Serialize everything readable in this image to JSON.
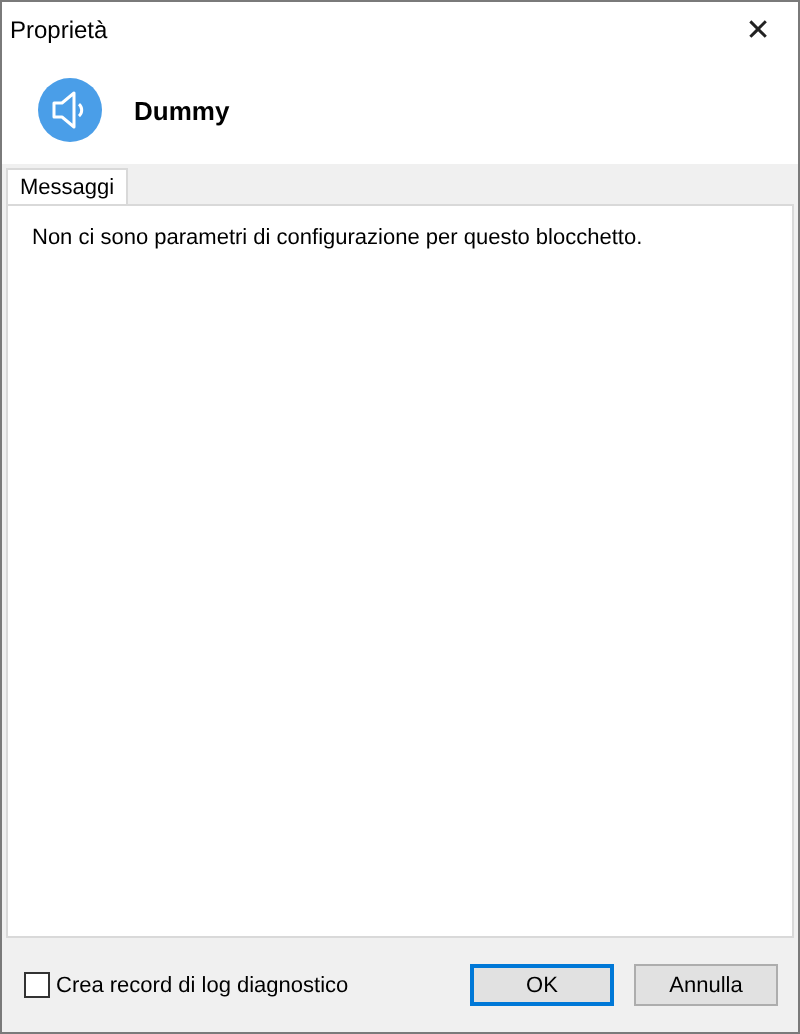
{
  "window": {
    "title": "Proprietà",
    "close": "✕"
  },
  "header": {
    "title": "Dummy"
  },
  "tabs": [
    {
      "label": "Messaggi",
      "selected": true
    }
  ],
  "message": "Non ci sono parametri di configurazione per questo blocchetto.",
  "footer": {
    "checkbox": {
      "label": "Crea record di log diagnostico",
      "checked": false
    },
    "buttons": [
      {
        "label": "OK",
        "default": true
      },
      {
        "label": "Annulla",
        "default": false
      }
    ]
  }
}
